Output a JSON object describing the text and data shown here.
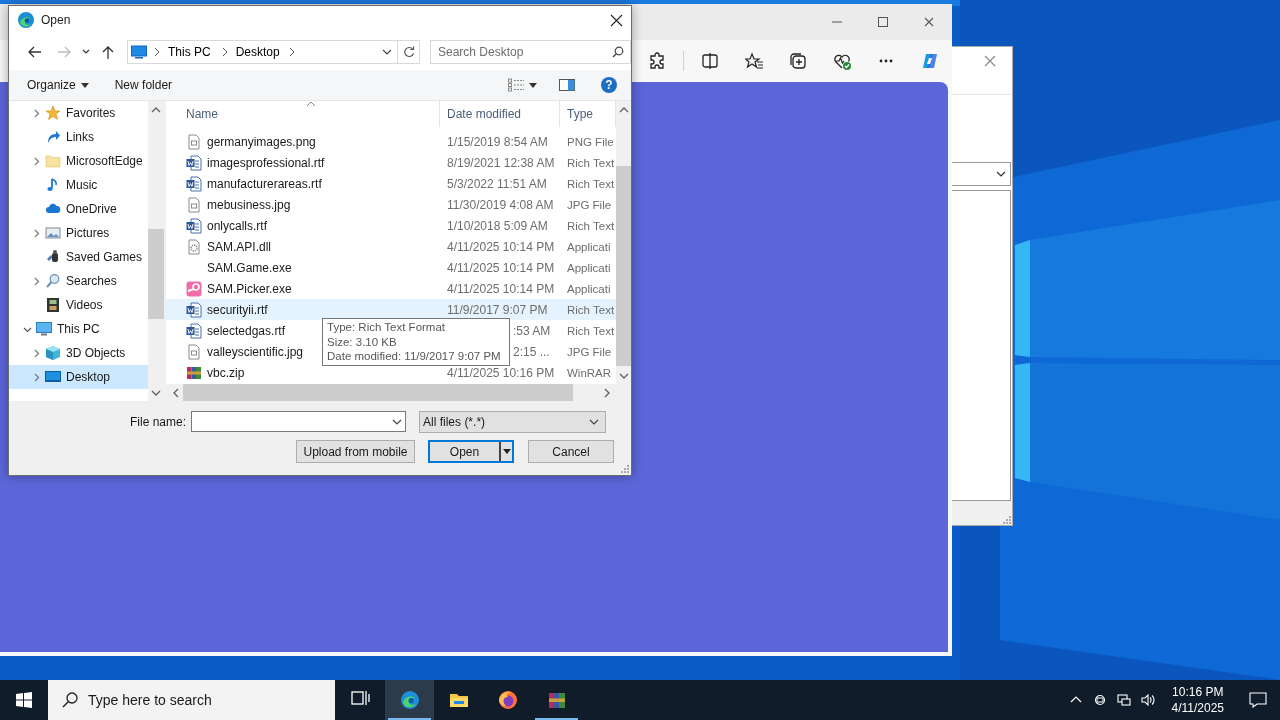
{
  "browser_window": {
    "toolbar": [
      {
        "kind": "extensions"
      },
      {
        "kind": "split"
      },
      {
        "kind": "favorites"
      },
      {
        "kind": "collections"
      },
      {
        "kind": "essentials"
      },
      {
        "kind": "more"
      },
      {
        "kind": "copilot"
      }
    ]
  },
  "open_dialog": {
    "title": "Open",
    "nav_buttons": [
      {
        "kind": "back",
        "disabled": false
      },
      {
        "kind": "forward",
        "disabled": true
      },
      {
        "kind": "recent",
        "disabled": false
      },
      {
        "kind": "up",
        "disabled": false
      }
    ],
    "breadcrumbs": [
      "This PC",
      "Desktop"
    ],
    "search": {
      "placeholder": "Search Desktop"
    },
    "toolbar": {
      "organize": "Organize",
      "new_folder": "New folder",
      "help": "?"
    },
    "nav": {
      "folder_items": [
        {
          "label": "Favorites",
          "kind": "star",
          "expandable": true
        },
        {
          "label": "Links",
          "kind": "link",
          "expandable": false
        },
        {
          "label": "MicrosoftEdge",
          "kind": "folder",
          "expandable": true
        },
        {
          "label": "Music",
          "kind": "music",
          "expandable": false
        },
        {
          "label": "OneDrive",
          "kind": "cloud",
          "expandable": false
        },
        {
          "label": "Pictures",
          "kind": "pictures",
          "expandable": true
        },
        {
          "label": "Saved Games",
          "kind": "games",
          "expandable": false
        },
        {
          "label": "Searches",
          "kind": "search",
          "expandable": true
        },
        {
          "label": "Videos",
          "kind": "video",
          "expandable": false
        }
      ],
      "roots": [
        {
          "label": "This PC",
          "kind": "pc",
          "expanded": true,
          "selected": false,
          "children": [
            {
              "label": "3D Objects",
              "kind": "cube",
              "expandable": true,
              "selected": false
            },
            {
              "label": "Desktop",
              "kind": "desktop",
              "expandable": true,
              "selected": true
            }
          ]
        }
      ]
    },
    "columns": [
      "Name",
      "Date modified",
      "Type"
    ],
    "rows": [
      {
        "name": "germanyimages.png",
        "date": "1/15/2019 8:54 AM",
        "type": "PNG File",
        "hovered": false,
        "date_partly_covered": false
      },
      {
        "name": "imagesprofessional.rtf",
        "kind": "rtf",
        "date": "8/19/2021 12:38 AM",
        "type": "Rich Text",
        "hovered": false,
        "date_partly_covered": false
      },
      {
        "name": "manufacturerareas.rtf",
        "kind": "rtf",
        "date": "5/3/2022 11:51 AM",
        "type": "Rich Text",
        "hovered": false,
        "date_partly_covered": false
      },
      {
        "name": "mebusiness.jpg",
        "date": "11/30/2019 4:08 AM",
        "type": "JPG File",
        "hovered": false,
        "date_partly_covered": false
      },
      {
        "name": "onlycalls.rtf",
        "kind": "rtf",
        "date": "1/10/2018 5:09 AM",
        "type": "Rich Text",
        "hovered": false,
        "date_partly_covered": false
      },
      {
        "name": "SAM.API.dll",
        "kind": "dll",
        "date": "4/11/2025 10:14 PM",
        "type": "Applicati",
        "hovered": false,
        "date_partly_covered": false
      },
      {
        "name": "SAM.Game.exe",
        "kind": "blank",
        "date": "4/11/2025 10:14 PM",
        "type": "Applicati",
        "hovered": false,
        "date_partly_covered": false
      },
      {
        "name": "SAM.Picker.exe",
        "kind": "app",
        "date": "4/11/2025 10:14 PM",
        "type": "Applicati",
        "hovered": false,
        "date_partly_covered": false
      },
      {
        "name": "securityii.rtf",
        "kind": "rtf",
        "date": "11/9/2017 9:07 PM",
        "type": "Rich Text",
        "hovered": true,
        "date_partly_covered": false
      },
      {
        "name": "selectedgas.rtf",
        "kind": "rtf",
        "date": ":53 AM",
        "type": "Rich Text",
        "hovered": false,
        "date_partly_covered": true
      },
      {
        "name": "valleyscientific.jpg",
        "date": "2:15 ...",
        "type": "JPG File",
        "hovered": false,
        "date_partly_covered": true
      },
      {
        "name": "vbc.zip",
        "kind": "zip",
        "date": "4/11/2025 10:16 PM",
        "type": "WinRAR",
        "hovered": false,
        "date_partly_covered": false
      }
    ],
    "tooltip": [
      "Type: Rich Text Format",
      "Size: 3.10 KB",
      "Date modified: 11/9/2017 9:07 PM"
    ],
    "file_name": {
      "label": "File name:"
    },
    "filter": "All files (*.*)",
    "buttons": [
      {
        "label": "Upload from mobile",
        "kind": "plain"
      },
      {
        "label": "Open",
        "kind": "split-default"
      },
      {
        "label": "Cancel",
        "kind": "plain"
      }
    ]
  },
  "taskbar": {
    "search_placeholder": "Type here to search",
    "apps": [
      {
        "kind": "task-view",
        "active": false,
        "running": false
      },
      {
        "kind": "edge",
        "active": true,
        "running": true
      },
      {
        "kind": "explorer",
        "active": false,
        "running": false
      },
      {
        "kind": "firefox",
        "active": false,
        "running": false
      },
      {
        "kind": "winrar",
        "active": false,
        "running": true
      }
    ],
    "clock": {
      "time": "10:16 PM",
      "date": "4/11/2025"
    }
  }
}
